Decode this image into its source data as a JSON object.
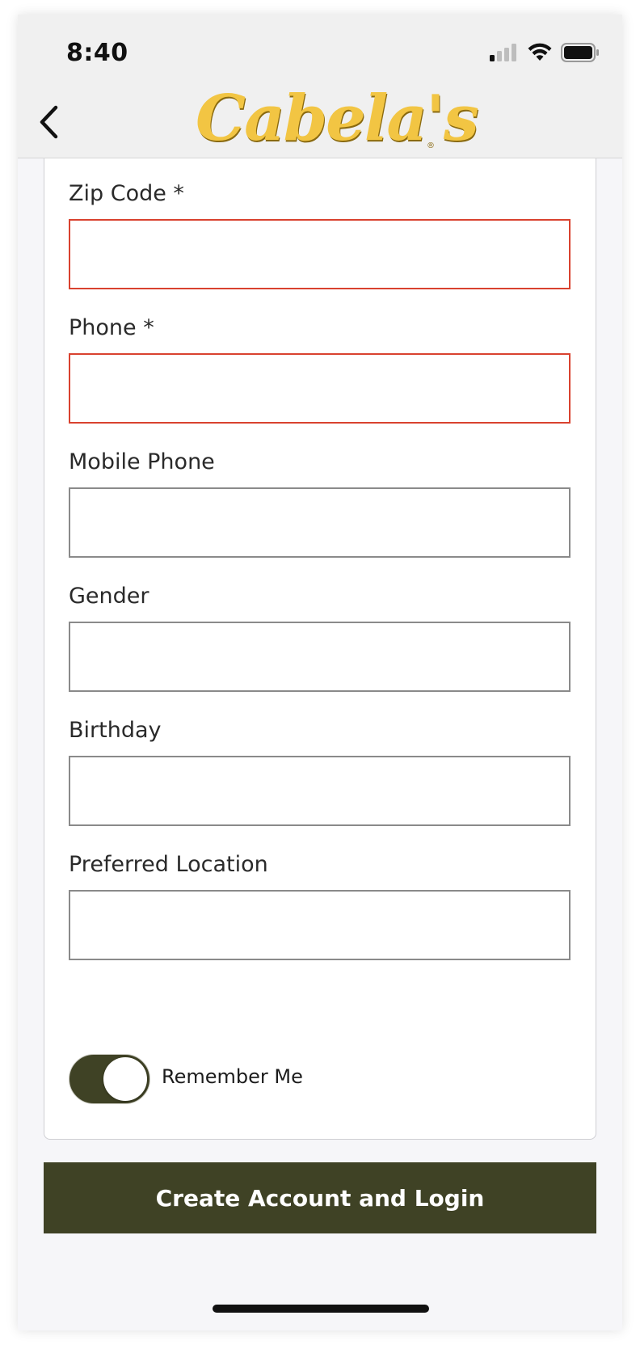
{
  "status_bar": {
    "time": "8:40",
    "icons": [
      "signal-icon",
      "wifi-icon",
      "battery-icon"
    ]
  },
  "nav": {
    "back_icon": "chevron-left-icon",
    "brand": "Cabela's",
    "brand_color": "#f2c543"
  },
  "form": {
    "fields": [
      {
        "label": "Zip Code *",
        "value": "",
        "state": "error"
      },
      {
        "label": "Phone *",
        "value": "",
        "state": "error"
      },
      {
        "label": "Mobile Phone",
        "value": "",
        "state": "normal"
      },
      {
        "label": "Gender",
        "value": "",
        "state": "normal"
      },
      {
        "label": "Birthday",
        "value": "",
        "state": "normal"
      },
      {
        "label": "Preferred Location",
        "value": "",
        "state": "normal"
      }
    ],
    "remember_me": {
      "label": "Remember Me",
      "checked": true
    }
  },
  "submit": {
    "label": "Create Account and Login"
  },
  "colors": {
    "primary": "#3f4225",
    "error": "#d9422f",
    "brand": "#f2c543"
  }
}
